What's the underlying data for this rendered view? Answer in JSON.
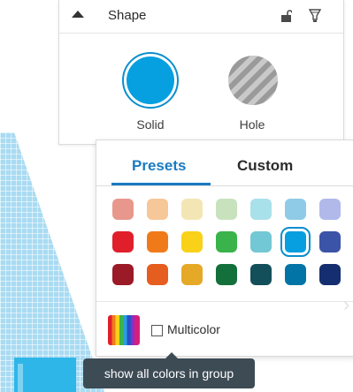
{
  "shape_panel": {
    "title": "Shape",
    "solid_label": "Solid",
    "hole_label": "Hole",
    "solid_color": "#069fe0"
  },
  "color_picker": {
    "tabs": [
      {
        "label": "Presets",
        "active": true
      },
      {
        "label": "Custom",
        "active": false
      }
    ],
    "presets": [
      [
        "#e8978c",
        "#f6c799",
        "#f4e6b4",
        "#c8e2bd",
        "#a9e1ea",
        "#8fcbe7",
        "#b0b9ea",
        "#9da6e8"
      ],
      [
        "#e01f2b",
        "#f07a1a",
        "#f8d118",
        "#3ab34a",
        "#72c8d4",
        "#079fe0",
        "#3b54a8",
        "#3a45b5"
      ],
      [
        "#9a1a27",
        "#e55d1f",
        "#e6a827",
        "#14703b",
        "#134f5a",
        "#0374a6",
        "#142e70",
        "#242a6e"
      ]
    ],
    "selected": {
      "row": 1,
      "col": 5
    },
    "multicolor_label": "Multicolor",
    "multicolor_checked": false
  },
  "tooltip": {
    "text": "show all colors in group"
  }
}
